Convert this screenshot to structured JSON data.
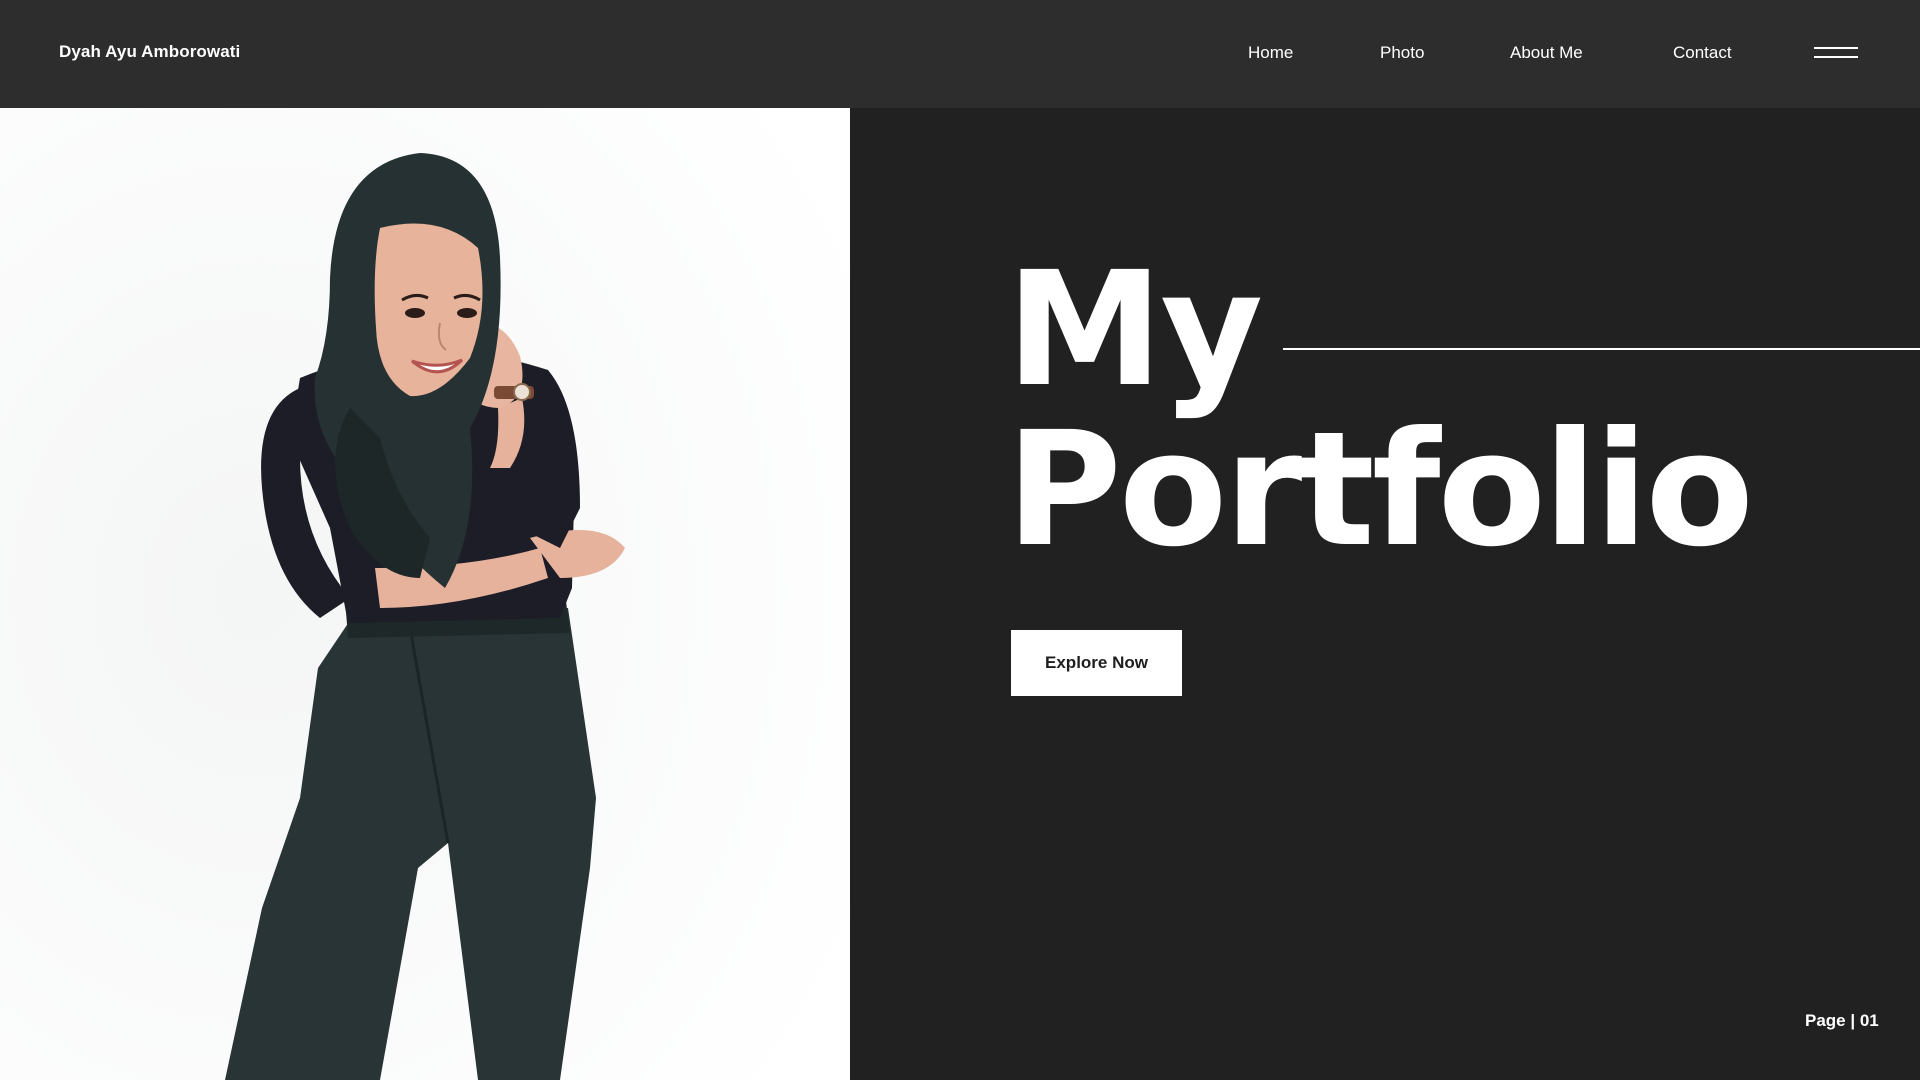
{
  "header": {
    "brand": "Dyah Ayu Amborowati",
    "nav": [
      {
        "label": "Home"
      },
      {
        "label": "Photo"
      },
      {
        "label": "About Me"
      },
      {
        "label": "Contact"
      }
    ],
    "menu_icon": "hamburger-menu-icon"
  },
  "hero": {
    "title_line1": "My",
    "title_line2": "Portfolio",
    "cta_label": "Explore Now"
  },
  "footer": {
    "page_indicator": "Page | 01"
  },
  "colors": {
    "header_bg": "#2d2d2d",
    "hero_bg": "#202120",
    "photo_bg": "#ffffff",
    "text": "#ffffff",
    "button_bg": "#ffffff",
    "button_text": "#1e1e1e"
  }
}
